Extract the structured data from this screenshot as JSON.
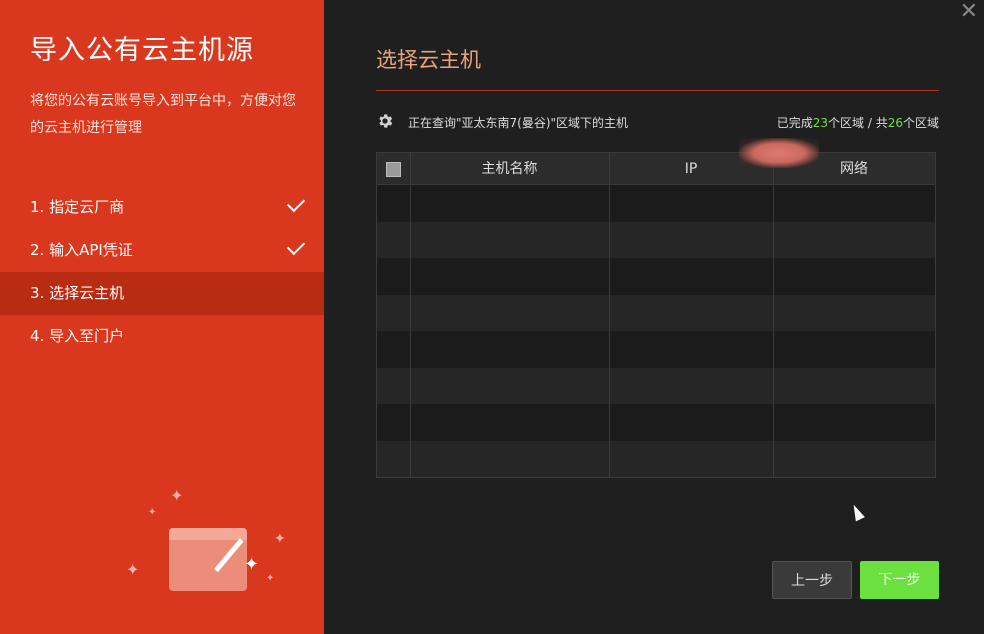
{
  "sidebar": {
    "title": "导入公有云主机源",
    "description": "将您的公有云账号导入到平台中，方便对您的云主机进行管理",
    "steps": [
      {
        "label": "1. 指定云厂商",
        "done": true
      },
      {
        "label": "2. 输入API凭证",
        "done": true
      },
      {
        "label": "3. 选择云主机",
        "done": false,
        "active": true
      },
      {
        "label": "4. 导入至门户",
        "done": false
      }
    ]
  },
  "main": {
    "title": "选择云主机",
    "status_text": "正在查询\"亚太东南7(曼谷)\"区域下的主机",
    "progress": {
      "prefix": "已完成",
      "done": "23",
      "middle": "个区域 / 共",
      "total": "26",
      "suffix": "个区域"
    },
    "table": {
      "columns": [
        "主机名称",
        "IP",
        "网络"
      ],
      "rows": []
    },
    "buttons": {
      "prev": "上一步",
      "next": "下一步"
    }
  },
  "window": {
    "close_glyph": "✕"
  },
  "colors": {
    "sidebar_bg": "#d9381e",
    "sidebar_active": "#b82c14",
    "accent_title": "#e9a47e",
    "highlight_green": "#6be04a",
    "next_button": "#6be03f"
  }
}
